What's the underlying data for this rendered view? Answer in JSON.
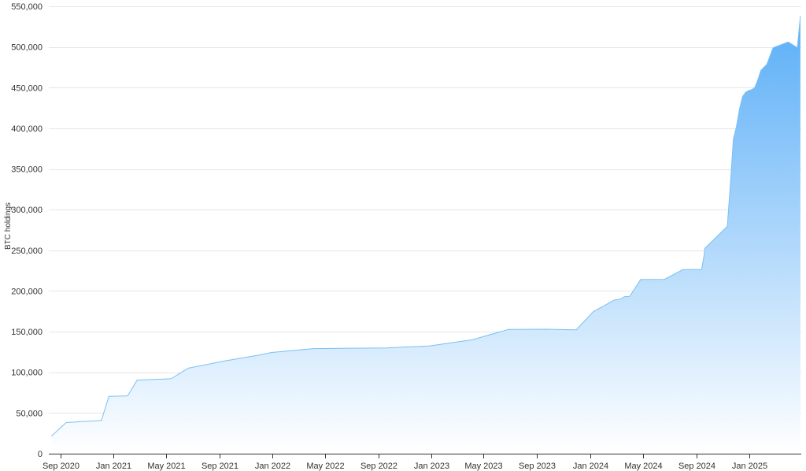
{
  "chart_data": {
    "type": "area",
    "xlabel": "",
    "ylabel": "BTC holdings",
    "ylim": [
      0,
      550000
    ],
    "y_ticks": [
      0,
      50000,
      100000,
      150000,
      200000,
      250000,
      300000,
      350000,
      400000,
      450000,
      500000,
      550000
    ],
    "y_tick_labels": [
      "0",
      "50,000",
      "100,000",
      "150,000",
      "200,000",
      "250,000",
      "300,000",
      "350,000",
      "400,000",
      "450,000",
      "500,000",
      "550,000"
    ],
    "x_tick_labels": [
      "Sep 2020",
      "Jan 2021",
      "May 2021",
      "Sep 2021",
      "Jan 2022",
      "May 2022",
      "Sep 2022",
      "Jan 2023",
      "May 2023",
      "Sep 2023",
      "Jan 2024",
      "May 2024",
      "Sep 2024",
      "Jan 2025"
    ],
    "x_tick_dates": [
      "2020-09-01",
      "2021-01-01",
      "2021-05-01",
      "2021-09-01",
      "2022-01-01",
      "2022-05-01",
      "2022-09-01",
      "2023-01-01",
      "2023-05-01",
      "2023-09-01",
      "2024-01-01",
      "2024-05-01",
      "2024-09-01",
      "2025-01-01"
    ],
    "xlim": [
      "2020-08-05",
      "2025-04-30"
    ],
    "grid": true,
    "colors": {
      "line": "#7cc0f2",
      "fill_top": "#5aaef7",
      "fill_bottom": "#ffffff"
    },
    "series": [
      {
        "x": [
          "2020-08-11",
          "2020-09-14",
          "2020-12-04",
          "2020-12-21",
          "2021-02-02",
          "2021-02-24",
          "2021-04-05",
          "2021-05-13",
          "2021-06-21",
          "2021-09-13",
          "2021-11-29",
          "2021-12-30",
          "2022-04-05",
          "2022-06-29",
          "2022-09-20",
          "2022-12-27",
          "2023-04-05",
          "2023-06-27",
          "2023-09-24",
          "2023-11-30",
          "2024-01-08",
          "2024-02-26",
          "2024-03-11",
          "2024-03-19",
          "2024-04-01",
          "2024-04-26",
          "2024-06-20",
          "2024-08-01",
          "2024-09-13",
          "2024-09-19",
          "2024-09-20",
          "2024-11-11",
          "2024-11-18",
          "2024-11-25",
          "2024-12-02",
          "2024-12-09",
          "2024-12-16",
          "2024-12-23",
          "2024-12-30",
          "2025-01-06",
          "2025-01-13",
          "2025-01-21",
          "2025-01-27",
          "2025-02-10",
          "2025-02-24",
          "2025-03-31",
          "2025-04-21",
          "2025-04-28"
        ],
        "values": [
          21454,
          38250,
          40824,
          70470,
          71079,
          90531,
          91326,
          92079,
          105085,
          114042,
          121044,
          124391,
          129218,
          129699,
          130000,
          132500,
          140000,
          152800,
          153000,
          152333,
          174530,
          189150,
          190000,
          193000,
          193500,
          214246,
          214400,
          226331,
          226500,
          244800,
          252220,
          279420,
          331200,
          386700,
          402100,
          423650,
          439000,
          444262,
          446400,
          447470,
          450000,
          461000,
          471107,
          478740,
          499096,
          506137,
          499096,
          538200
        ]
      }
    ]
  }
}
